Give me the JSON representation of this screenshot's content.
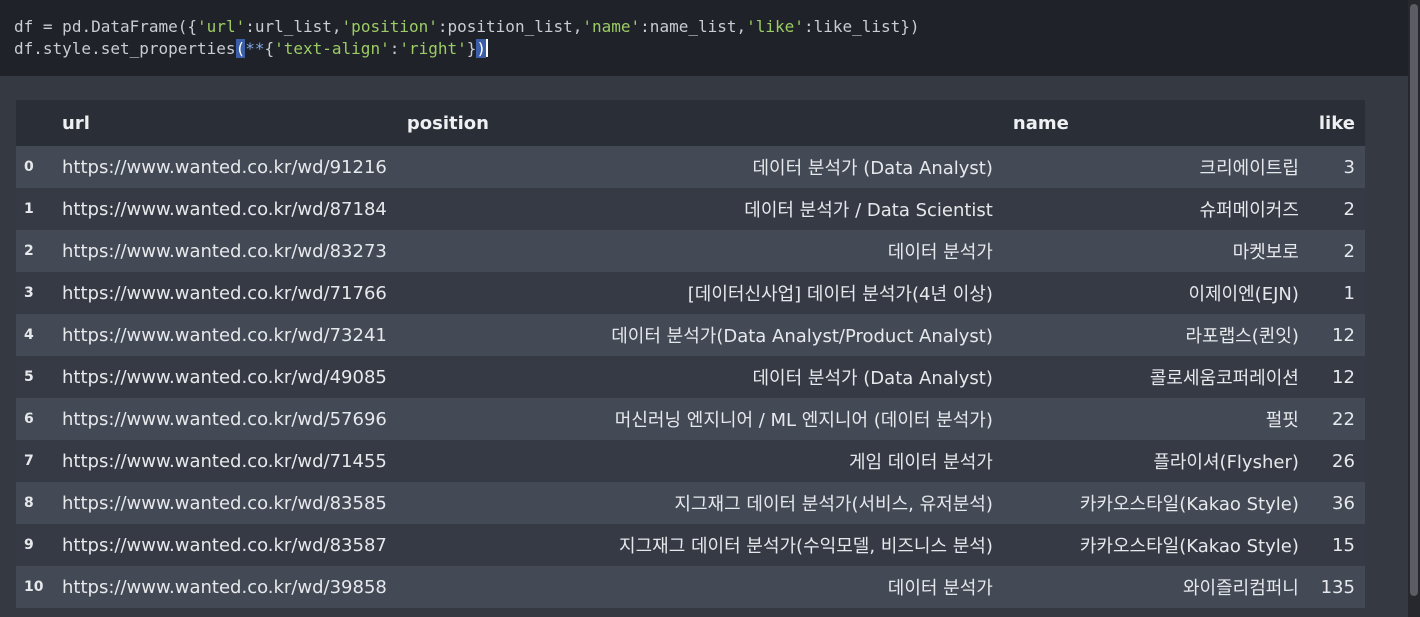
{
  "code": {
    "line1": {
      "p1": "df ",
      "p2": "=",
      "p3": " pd.DataFrame({",
      "s1": "'url'",
      "p4": ":url_list,",
      "s2": "'position'",
      "p5": ":position_list,",
      "s3": "'name'",
      "p6": ":name_list,",
      "s4": "'like'",
      "p7": ":like_list})"
    },
    "line2": {
      "p1": "df.style.set_properties",
      "b1": "(",
      "k1": "**",
      "p2": "{",
      "s1": "'text-align'",
      "p3": ":",
      "s2": "'right'",
      "p4": "}",
      "b2": ")"
    }
  },
  "table": {
    "headers": {
      "index": "",
      "url": "url",
      "position": "position",
      "name": "name",
      "like": "like"
    },
    "rows": [
      {
        "index": "0",
        "url": "https://www.wanted.co.kr/wd/91216",
        "position": "데이터 분석가 (Data Analyst)",
        "name": "크리에이트립",
        "like": "3"
      },
      {
        "index": "1",
        "url": "https://www.wanted.co.kr/wd/87184",
        "position": "데이터 분석가 / Data Scientist",
        "name": "슈퍼메이커즈",
        "like": "2"
      },
      {
        "index": "2",
        "url": "https://www.wanted.co.kr/wd/83273",
        "position": "데이터 분석가",
        "name": "마켓보로",
        "like": "2"
      },
      {
        "index": "3",
        "url": "https://www.wanted.co.kr/wd/71766",
        "position": "[데이터신사업] 데이터 분석가(4년 이상)",
        "name": "이제이엔(EJN)",
        "like": "1"
      },
      {
        "index": "4",
        "url": "https://www.wanted.co.kr/wd/73241",
        "position": "데이터 분석가(Data Analyst/Product Analyst)",
        "name": "라포랩스(퀸잇)",
        "like": "12"
      },
      {
        "index": "5",
        "url": "https://www.wanted.co.kr/wd/49085",
        "position": "데이터 분석가 (Data Analyst)",
        "name": "콜로세움코퍼레이션",
        "like": "12"
      },
      {
        "index": "6",
        "url": "https://www.wanted.co.kr/wd/57696",
        "position": "머신러닝 엔지니어 / ML 엔지니어 (데이터 분석가)",
        "name": "펄핏",
        "like": "22"
      },
      {
        "index": "7",
        "url": "https://www.wanted.co.kr/wd/71455",
        "position": "게임 데이터 분석가",
        "name": "플라이셔(Flysher)",
        "like": "26"
      },
      {
        "index": "8",
        "url": "https://www.wanted.co.kr/wd/83585",
        "position": "지그재그 데이터 분석가(서비스, 유저분석)",
        "name": "카카오스타일(Kakao Style)",
        "like": "36"
      },
      {
        "index": "9",
        "url": "https://www.wanted.co.kr/wd/83587",
        "position": "지그재그 데이터 분석가(수익모델, 비즈니스 분석)",
        "name": "카카오스타일(Kakao Style)",
        "like": "15"
      },
      {
        "index": "10",
        "url": "https://www.wanted.co.kr/wd/39858",
        "position": "데이터 분석가",
        "name": "와이즐리컴퍼니",
        "like": "135"
      }
    ]
  }
}
